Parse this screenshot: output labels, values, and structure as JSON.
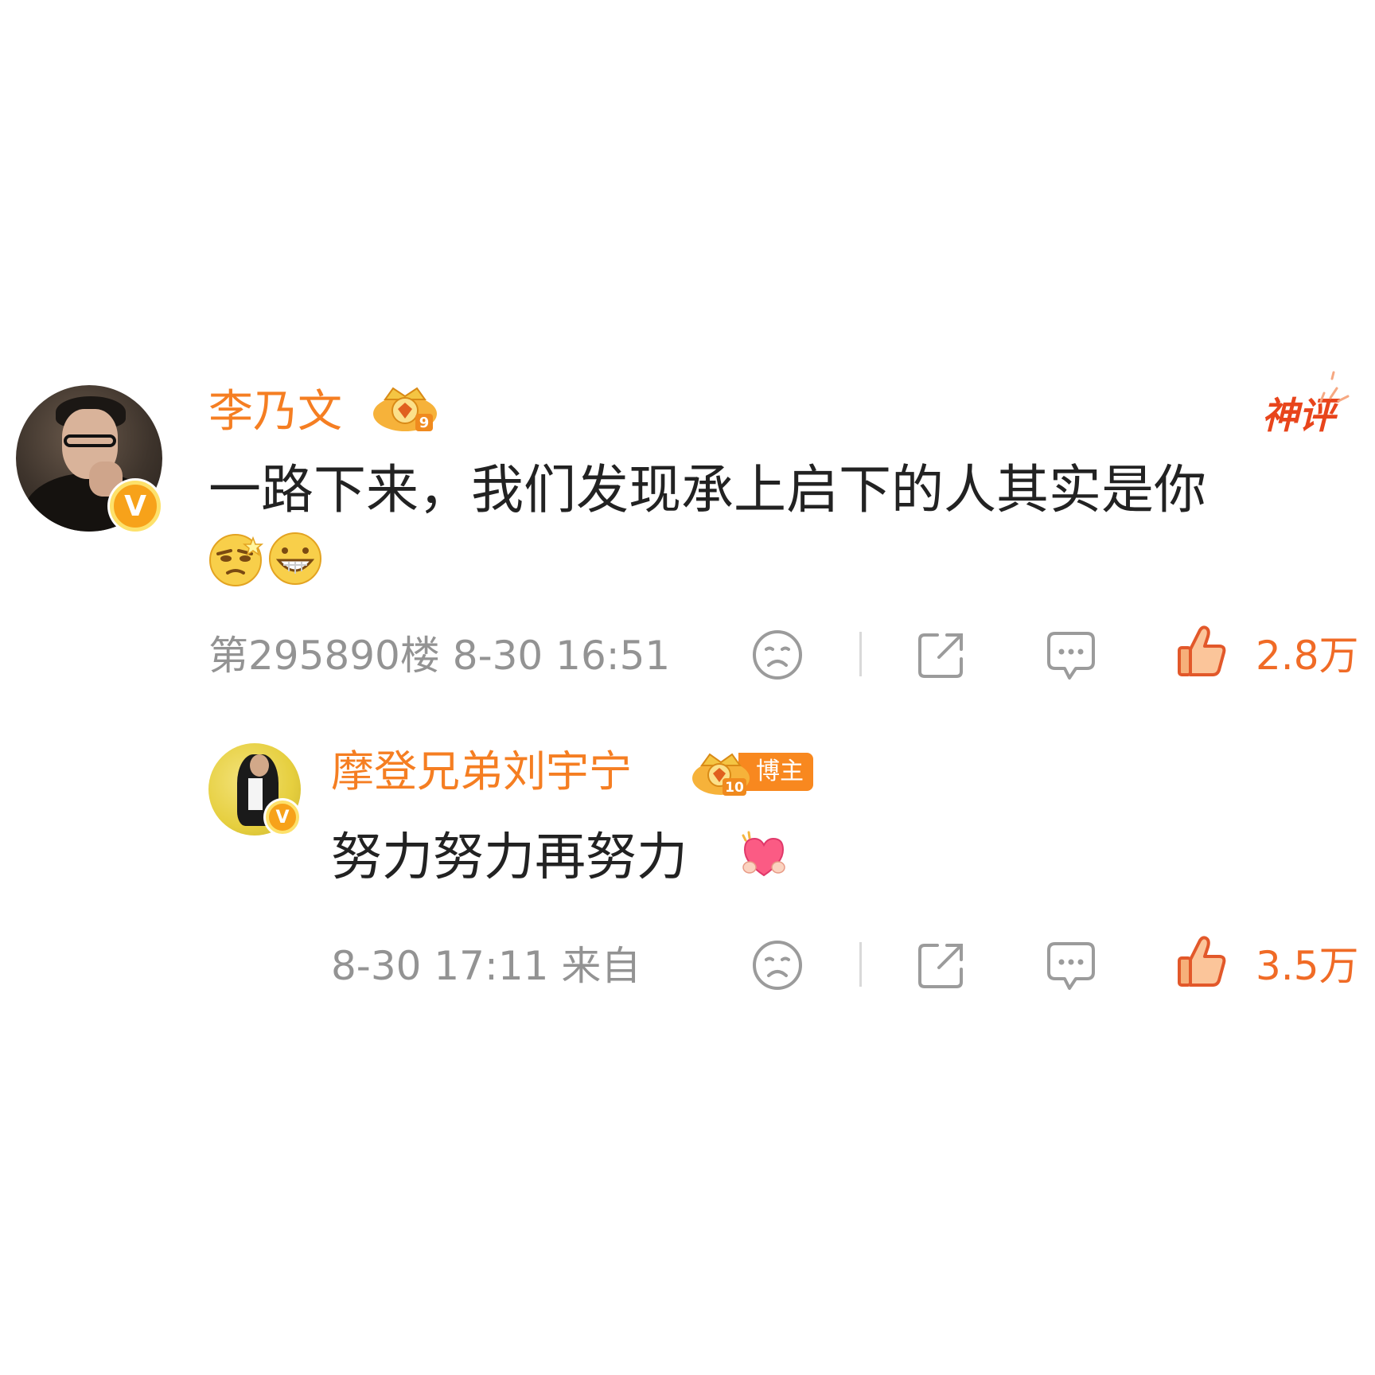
{
  "comment": {
    "author": "李乃文",
    "tag": "神评",
    "text": "一路下来，我们发现承上启下的人其实是你",
    "emojis": [
      "smug-face-emoji",
      "grinning-face-emoji"
    ],
    "floor_and_time": "第295890楼 8-30 16:51",
    "likes": "2.8万"
  },
  "reply": {
    "author": "摩登兄弟刘宇宁",
    "badge": "博主",
    "text": "努力努力再努力",
    "emojis": [
      "heart-hug-emoji"
    ],
    "time_and_source": "8-30 17:11 来自",
    "likes": "3.5万"
  },
  "colors": {
    "name": "#f57e22",
    "like": "#f06b26",
    "meta": "#939393",
    "shenping": "#e8451c"
  }
}
